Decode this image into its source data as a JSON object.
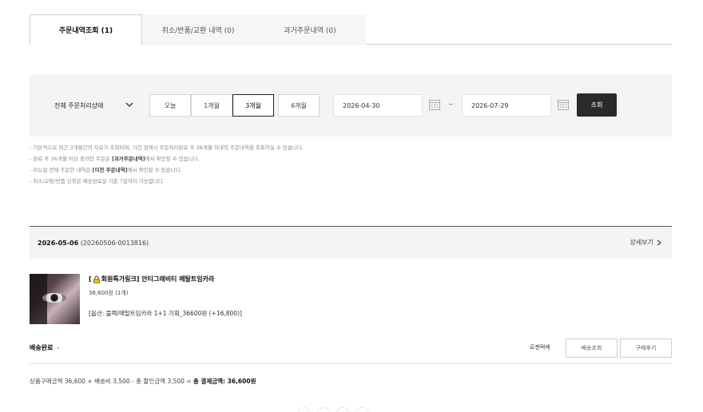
{
  "tabs": [
    {
      "label": "주문내역조회 (1)"
    },
    {
      "label": "취소/반품/교환 내역 (0)"
    },
    {
      "label": "과거주문내역 (0)"
    }
  ],
  "filter": {
    "status_select": "전체 주문처리상태",
    "periods": [
      "오늘",
      "1개월",
      "3개월",
      "6개월"
    ],
    "active_period": "3개월",
    "start_date": "2026-04-30",
    "end_date": "2026-07-29",
    "tilde": "~",
    "search_label": "조회"
  },
  "notices": {
    "line1": "- 기본적으로 최근 3개월간의 자료가 조회되며, 기간 검색시 주문처리완료 후 36개월 이내의 주문내역을 조회하실 수 있습니다.",
    "line2_pre": "- 완료 후 36개월 이상 경과한 주문은 ",
    "line2_bold": "[과거주문내역]",
    "line2_post": "에서 확인할 수 있습니다.",
    "line3_pre": "- 리뉴얼 전에 주문한 내역은 ",
    "line3_bold": "[이전 주문내역]",
    "line3_post": "에서 확인할 수 있습니다.",
    "line4": "- 취소/교환/반품 신청은 배송완료일 기준 7일까지 가능합니다."
  },
  "order": {
    "date": "2026-05-06",
    "order_no": "(20260506-0013816)",
    "detail_label": "상세보기",
    "product_title_pre": "[",
    "product_title_post": "회원특가링크] 안티그래비티 메탈트임카라",
    "price": "36,600원 (1개)",
    "option": "[옵션: 블랙/메탈트임카라 1+1 기획_36600원 (+16,800)]",
    "ship_status": "배송완료",
    "ship_dash": "-",
    "carrier": "로젠택배",
    "track_label": "배송조회",
    "review_label": "구매후기",
    "summary_pre": "상품구매금액 36,600 + 배송비 3,500 - 총 할인금액 3,500 = ",
    "summary_bold": "총 결제금액: 36,600원"
  }
}
